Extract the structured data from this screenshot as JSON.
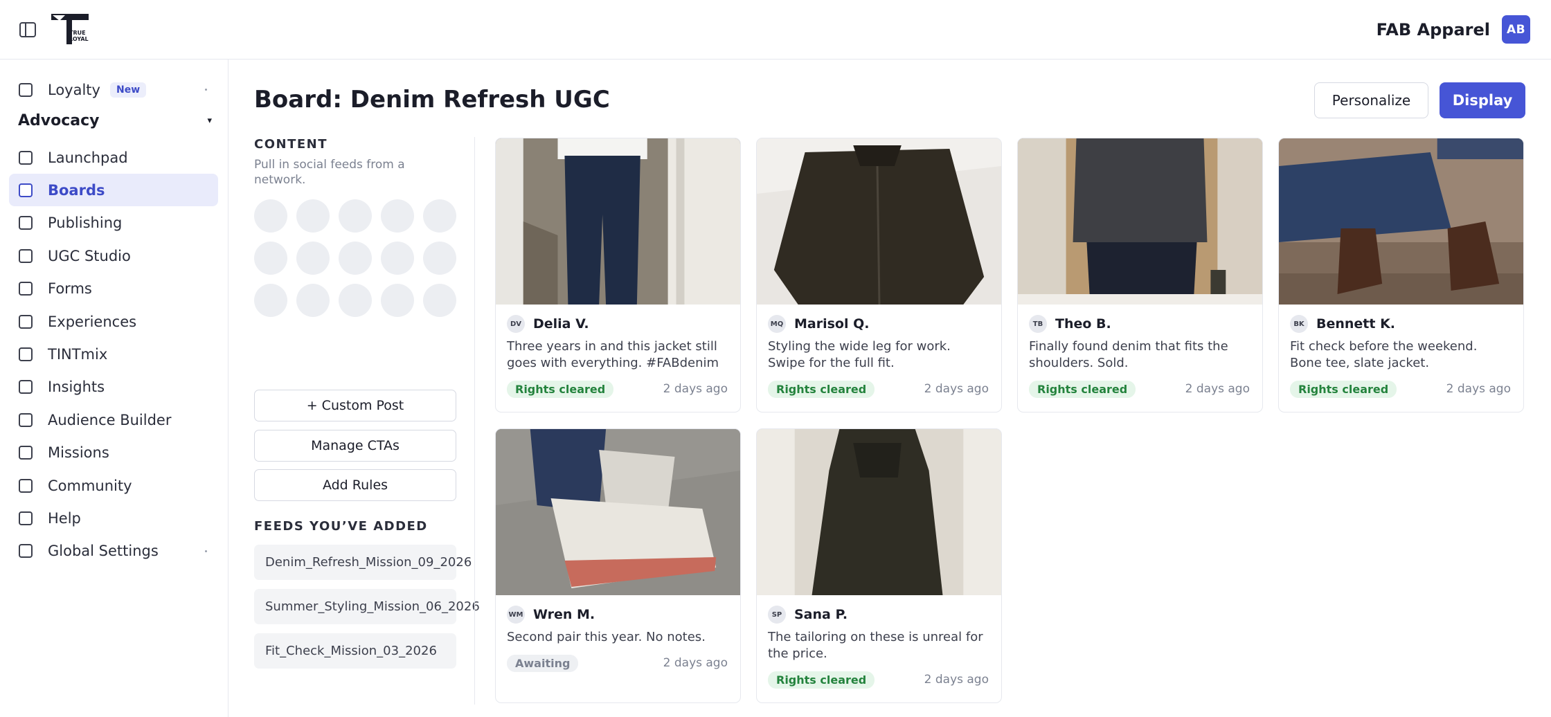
{
  "header": {
    "company": "FAB Apparel",
    "avatar_initials": "AB",
    "logo_text_1": "TRUE",
    "logo_text_2": "LOYAL"
  },
  "sidebar": {
    "loyalty": {
      "label": "Loyalty",
      "badge": "New"
    },
    "section": {
      "label": "Advocacy",
      "caret": "▾"
    },
    "items": [
      {
        "label": "Launchpad"
      },
      {
        "label": "Boards"
      },
      {
        "label": "Publishing"
      },
      {
        "label": "UGC Studio"
      },
      {
        "label": "Forms"
      },
      {
        "label": "Experiences"
      },
      {
        "label": "TINTmix"
      },
      {
        "label": "Insights"
      },
      {
        "label": "Audience Builder"
      },
      {
        "label": "Missions"
      },
      {
        "label": "Community"
      },
      {
        "label": "Help"
      },
      {
        "label": "Global Settings"
      }
    ],
    "active_item": "Boards"
  },
  "main": {
    "title": "Board: Denim Refresh UGC",
    "personalize_label": "Personalize",
    "display_label": "Display",
    "content": {
      "label": "CONTENT",
      "subtitle": "Pull in social feeds from a network.",
      "custom_post": "+ Custom Post",
      "manage_ctas": "Manage CTAs",
      "add_rules": "Add Rules",
      "feeds_label": "FEEDS YOU’VE ADDED",
      "feeds": [
        "Denim_Refresh_Mission_09_2026",
        "Summer_Styling_Mission_06_2026",
        "Fit_Check_Mission_03_2026"
      ]
    },
    "posts": [
      {
        "initials": "DV",
        "name": "Delia V.",
        "caption": "Three years in and this jacket still goes with everything. #FABdenim",
        "status": "Rights cleared",
        "time": "2 days ago"
      },
      {
        "initials": "MQ",
        "name": "Marisol Q.",
        "caption": "Styling the wide leg for work. Swipe for the full fit.",
        "status": "Rights cleared",
        "time": "2 days ago"
      },
      {
        "initials": "TB",
        "name": "Theo B.",
        "caption": "Finally found denim that fits the shoulders. Sold.",
        "status": "Rights cleared",
        "time": "2 days ago"
      },
      {
        "initials": "BK",
        "name": "Bennett K.",
        "caption": "Fit check before the weekend. Bone tee, slate jacket.",
        "status": "Rights cleared",
        "time": "2 days ago"
      },
      {
        "initials": "WM",
        "name": "Wren M.",
        "caption": "Second pair this year. No notes.",
        "status": "Awaiting",
        "time": "2 days ago"
      },
      {
        "initials": "SP",
        "name": "Sana P.",
        "caption": "The tailoring on these is unreal for the price.",
        "status": "Rights cleared",
        "time": "2 days ago"
      }
    ]
  },
  "colors": {
    "accent": "#4655d6",
    "active_bg": "#e9ebfb",
    "cleared_bg": "#e5f5e9",
    "cleared_text": "#24833d"
  }
}
